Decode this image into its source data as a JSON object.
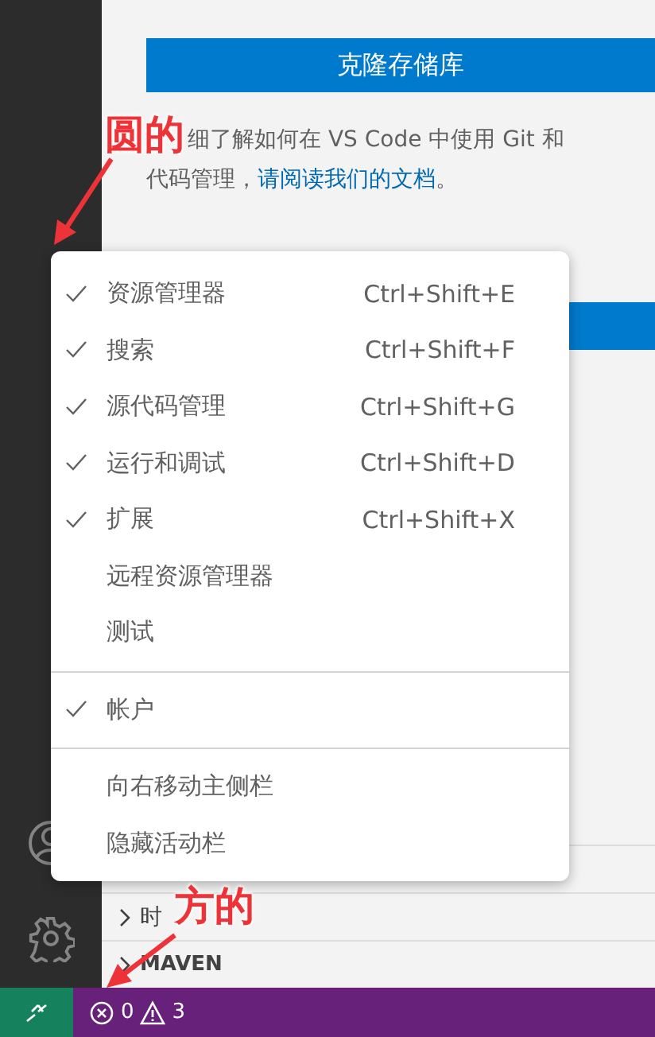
{
  "editor": {
    "clone_button": "克隆存储库",
    "paragraph": {
      "before": "细了解如何在 VS Code 中使用 Git 和",
      "line2": "代码管理，",
      "link": "请阅读我们的文档",
      "after": "。"
    },
    "sections": [
      {
        "title": "时",
        "expanded": false
      },
      {
        "title": "MAVEN",
        "expanded": false
      }
    ]
  },
  "context_menu": {
    "groups": [
      [
        {
          "label": "资源管理器",
          "checked": true,
          "shortcut": "Ctrl+Shift+E"
        },
        {
          "label": "搜索",
          "checked": true,
          "shortcut": "Ctrl+Shift+F"
        },
        {
          "label": "源代码管理",
          "checked": true,
          "shortcut": "Ctrl+Shift+G"
        },
        {
          "label": "运行和调试",
          "checked": true,
          "shortcut": "Ctrl+Shift+D"
        },
        {
          "label": "扩展",
          "checked": true,
          "shortcut": "Ctrl+Shift+X"
        },
        {
          "label": "远程资源管理器",
          "checked": false
        },
        {
          "label": "测试",
          "checked": false
        }
      ],
      [
        {
          "label": "帐户",
          "checked": true
        }
      ],
      [
        {
          "label": "向右移动主侧栏",
          "checked": false
        },
        {
          "label": "隐藏活动栏",
          "checked": false
        }
      ]
    ]
  },
  "annotations": [
    {
      "text": "圆的"
    },
    {
      "text": "方的"
    }
  ],
  "status_bar": {
    "errors": "0",
    "warnings": "3"
  }
}
